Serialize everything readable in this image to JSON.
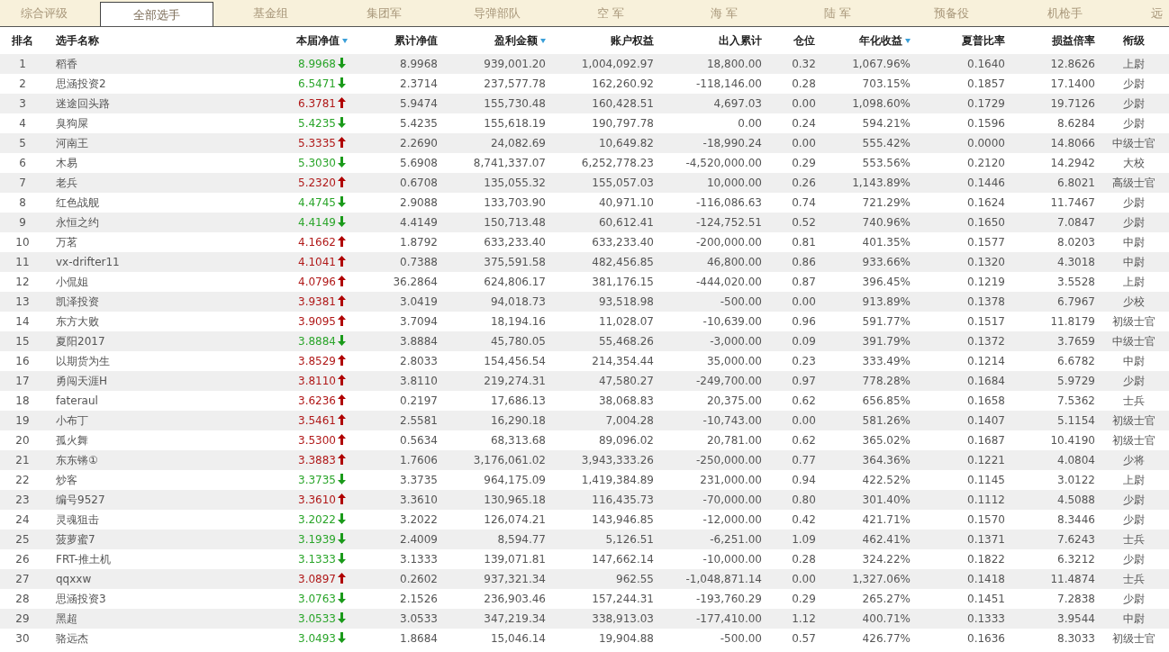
{
  "tabs": [
    {
      "label": "综合评级",
      "selected": false
    },
    {
      "label": "全部选手",
      "selected": true
    },
    {
      "label": "基金组",
      "selected": false
    },
    {
      "label": "集团军",
      "selected": false
    },
    {
      "label": "导弹部队",
      "selected": false
    },
    {
      "label": "空 军",
      "selected": false
    },
    {
      "label": "海 军",
      "selected": false
    },
    {
      "label": "陆 军",
      "selected": false
    },
    {
      "label": "预备役",
      "selected": false
    },
    {
      "label": "机枪手",
      "selected": false
    },
    {
      "label": "远",
      "selected": false
    }
  ],
  "table": {
    "columns": [
      {
        "label": "排名",
        "sorted": false
      },
      {
        "label": "选手名称",
        "sorted": false
      },
      {
        "label": "本届净值",
        "sorted": true
      },
      {
        "label": "累计净值",
        "sorted": false
      },
      {
        "label": "盈利金额",
        "sorted": true
      },
      {
        "label": "账户权益",
        "sorted": false
      },
      {
        "label": "出入累计",
        "sorted": false
      },
      {
        "label": "仓位",
        "sorted": false
      },
      {
        "label": "年化收益",
        "sorted": true
      },
      {
        "label": "夏普比率",
        "sorted": false
      },
      {
        "label": "损益倍率",
        "sorted": false
      },
      {
        "label": "衔级",
        "sorted": false
      }
    ],
    "rows": [
      {
        "rising": false,
        "cells": [
          "1",
          "稻香",
          "8.9968",
          "8.9968",
          "939,001.20",
          "1,004,092.97",
          "18,800.00",
          "0.32",
          "1,067.96%",
          "0.1640",
          "12.8626",
          "上尉"
        ]
      },
      {
        "rising": false,
        "cells": [
          "2",
          "思涵投资2",
          "6.5471",
          "2.3714",
          "237,577.78",
          "162,260.92",
          "-118,146.00",
          "0.28",
          "703.15%",
          "0.1857",
          "17.1400",
          "少尉"
        ]
      },
      {
        "rising": true,
        "cells": [
          "3",
          "迷途回头路",
          "6.3781",
          "5.9474",
          "155,730.48",
          "160,428.51",
          "4,697.03",
          "0.00",
          "1,098.60%",
          "0.1729",
          "19.7126",
          "少尉"
        ]
      },
      {
        "rising": false,
        "cells": [
          "4",
          "臭狗屎",
          "5.4235",
          "5.4235",
          "155,618.19",
          "190,797.78",
          "0.00",
          "0.24",
          "594.21%",
          "0.1596",
          "8.6284",
          "少尉"
        ]
      },
      {
        "rising": true,
        "cells": [
          "5",
          "河南王",
          "5.3335",
          "2.2690",
          "24,082.69",
          "10,649.82",
          "-18,990.24",
          "0.00",
          "555.42%",
          "0.0000",
          "14.8066",
          "中级士官"
        ]
      },
      {
        "rising": false,
        "cells": [
          "6",
          "木易",
          "5.3030",
          "5.6908",
          "8,741,337.07",
          "6,252,778.23",
          "-4,520,000.00",
          "0.29",
          "553.56%",
          "0.2120",
          "14.2942",
          "大校"
        ]
      },
      {
        "rising": true,
        "cells": [
          "7",
          "老兵",
          "5.2320",
          "0.6708",
          "135,055.32",
          "155,057.03",
          "10,000.00",
          "0.26",
          "1,143.89%",
          "0.1446",
          "6.8021",
          "高级士官"
        ]
      },
      {
        "rising": false,
        "cells": [
          "8",
          "红色战舰",
          "4.4745",
          "2.9088",
          "133,703.90",
          "40,971.10",
          "-116,086.63",
          "0.74",
          "721.29%",
          "0.1624",
          "11.7467",
          "少尉"
        ]
      },
      {
        "rising": false,
        "cells": [
          "9",
          "永恒之约",
          "4.4149",
          "4.4149",
          "150,713.48",
          "60,612.41",
          "-124,752.51",
          "0.52",
          "740.96%",
          "0.1650",
          "7.0847",
          "少尉"
        ]
      },
      {
        "rising": true,
        "cells": [
          "10",
          "万茗",
          "4.1662",
          "1.8792",
          "633,233.40",
          "633,233.40",
          "-200,000.00",
          "0.81",
          "401.35%",
          "0.1577",
          "8.0203",
          "中尉"
        ]
      },
      {
        "rising": true,
        "cells": [
          "11",
          "vx-drifter11",
          "4.1041",
          "0.7388",
          "375,591.58",
          "482,456.85",
          "46,800.00",
          "0.86",
          "933.66%",
          "0.1320",
          "4.3018",
          "中尉"
        ]
      },
      {
        "rising": true,
        "cells": [
          "12",
          "小侃姐",
          "4.0796",
          "36.2864",
          "624,806.17",
          "381,176.15",
          "-444,020.00",
          "0.87",
          "396.45%",
          "0.1219",
          "3.5528",
          "上尉"
        ]
      },
      {
        "rising": true,
        "cells": [
          "13",
          "凯泽投资",
          "3.9381",
          "3.0419",
          "94,018.73",
          "93,518.98",
          "-500.00",
          "0.00",
          "913.89%",
          "0.1378",
          "6.7967",
          "少校"
        ]
      },
      {
        "rising": true,
        "cells": [
          "14",
          "东方大败",
          "3.9095",
          "3.7094",
          "18,194.16",
          "11,028.07",
          "-10,639.00",
          "0.96",
          "591.77%",
          "0.1517",
          "11.8179",
          "初级士官"
        ]
      },
      {
        "rising": false,
        "cells": [
          "15",
          "夏阳2017",
          "3.8884",
          "3.8884",
          "45,780.05",
          "55,468.26",
          "-3,000.00",
          "0.09",
          "391.79%",
          "0.1372",
          "3.7659",
          "中级士官"
        ]
      },
      {
        "rising": true,
        "cells": [
          "16",
          "以期货为生",
          "3.8529",
          "2.8033",
          "154,456.54",
          "214,354.44",
          "35,000.00",
          "0.23",
          "333.49%",
          "0.1214",
          "6.6782",
          "中尉"
        ]
      },
      {
        "rising": true,
        "cells": [
          "17",
          "勇闯天涯H",
          "3.8110",
          "3.8110",
          "219,274.31",
          "47,580.27",
          "-249,700.00",
          "0.97",
          "778.28%",
          "0.1684",
          "5.9729",
          "少尉"
        ]
      },
      {
        "rising": true,
        "cells": [
          "18",
          "fateraul",
          "3.6236",
          "0.2197",
          "17,686.13",
          "38,068.83",
          "20,375.00",
          "0.62",
          "656.85%",
          "0.1658",
          "7.5362",
          "士兵"
        ]
      },
      {
        "rising": true,
        "cells": [
          "19",
          "小布丁",
          "3.5461",
          "2.5581",
          "16,290.18",
          "7,004.28",
          "-10,743.00",
          "0.00",
          "581.26%",
          "0.1407",
          "5.1154",
          "初级士官"
        ]
      },
      {
        "rising": true,
        "cells": [
          "20",
          "孤火舞",
          "3.5300",
          "0.5634",
          "68,313.68",
          "89,096.02",
          "20,781.00",
          "0.62",
          "365.02%",
          "0.1687",
          "10.4190",
          "初级士官"
        ]
      },
      {
        "rising": true,
        "cells": [
          "21",
          "东东锵①",
          "3.3883",
          "1.7606",
          "3,176,061.02",
          "3,943,333.26",
          "-250,000.00",
          "0.77",
          "364.36%",
          "0.1221",
          "4.0804",
          "少将"
        ]
      },
      {
        "rising": false,
        "cells": [
          "22",
          "炒客",
          "3.3735",
          "3.3735",
          "964,175.09",
          "1,419,384.89",
          "231,000.00",
          "0.94",
          "422.52%",
          "0.1145",
          "3.0122",
          "上尉"
        ]
      },
      {
        "rising": true,
        "cells": [
          "23",
          "编号9527",
          "3.3610",
          "3.3610",
          "130,965.18",
          "116,435.73",
          "-70,000.00",
          "0.80",
          "301.40%",
          "0.1112",
          "4.5088",
          "少尉"
        ]
      },
      {
        "rising": false,
        "cells": [
          "24",
          "灵魂狙击",
          "3.2022",
          "3.2022",
          "126,074.21",
          "143,946.85",
          "-12,000.00",
          "0.42",
          "421.71%",
          "0.1570",
          "8.3446",
          "少尉"
        ]
      },
      {
        "rising": false,
        "cells": [
          "25",
          "菠萝蜜7",
          "3.1939",
          "2.4009",
          "8,594.77",
          "5,126.51",
          "-6,251.00",
          "1.09",
          "462.41%",
          "0.1371",
          "7.6243",
          "士兵"
        ]
      },
      {
        "rising": false,
        "cells": [
          "26",
          "FRT-推土机",
          "3.1333",
          "3.1333",
          "139,071.81",
          "147,662.14",
          "-10,000.00",
          "0.28",
          "324.22%",
          "0.1822",
          "6.3212",
          "少尉"
        ]
      },
      {
        "rising": true,
        "cells": [
          "27",
          "qqxxw",
          "3.0897",
          "0.2602",
          "937,321.34",
          "962.55",
          "-1,048,871.14",
          "0.00",
          "1,327.06%",
          "0.1418",
          "11.4874",
          "士兵"
        ]
      },
      {
        "rising": false,
        "cells": [
          "28",
          "思涵投资3",
          "3.0763",
          "2.1526",
          "236,903.46",
          "157,244.31",
          "-193,760.29",
          "0.29",
          "265.27%",
          "0.1451",
          "7.2838",
          "少尉"
        ]
      },
      {
        "rising": false,
        "cells": [
          "29",
          "黑超",
          "3.0533",
          "3.0533",
          "347,219.34",
          "338,913.03",
          "-177,410.00",
          "1.12",
          "400.71%",
          "0.1333",
          "3.9544",
          "中尉"
        ]
      },
      {
        "rising": false,
        "cells": [
          "30",
          "骆远杰",
          "3.0493",
          "1.8684",
          "15,046.14",
          "19,904.88",
          "-500.00",
          "0.57",
          "426.77%",
          "0.1636",
          "8.3033",
          "初级士官"
        ]
      }
    ]
  }
}
